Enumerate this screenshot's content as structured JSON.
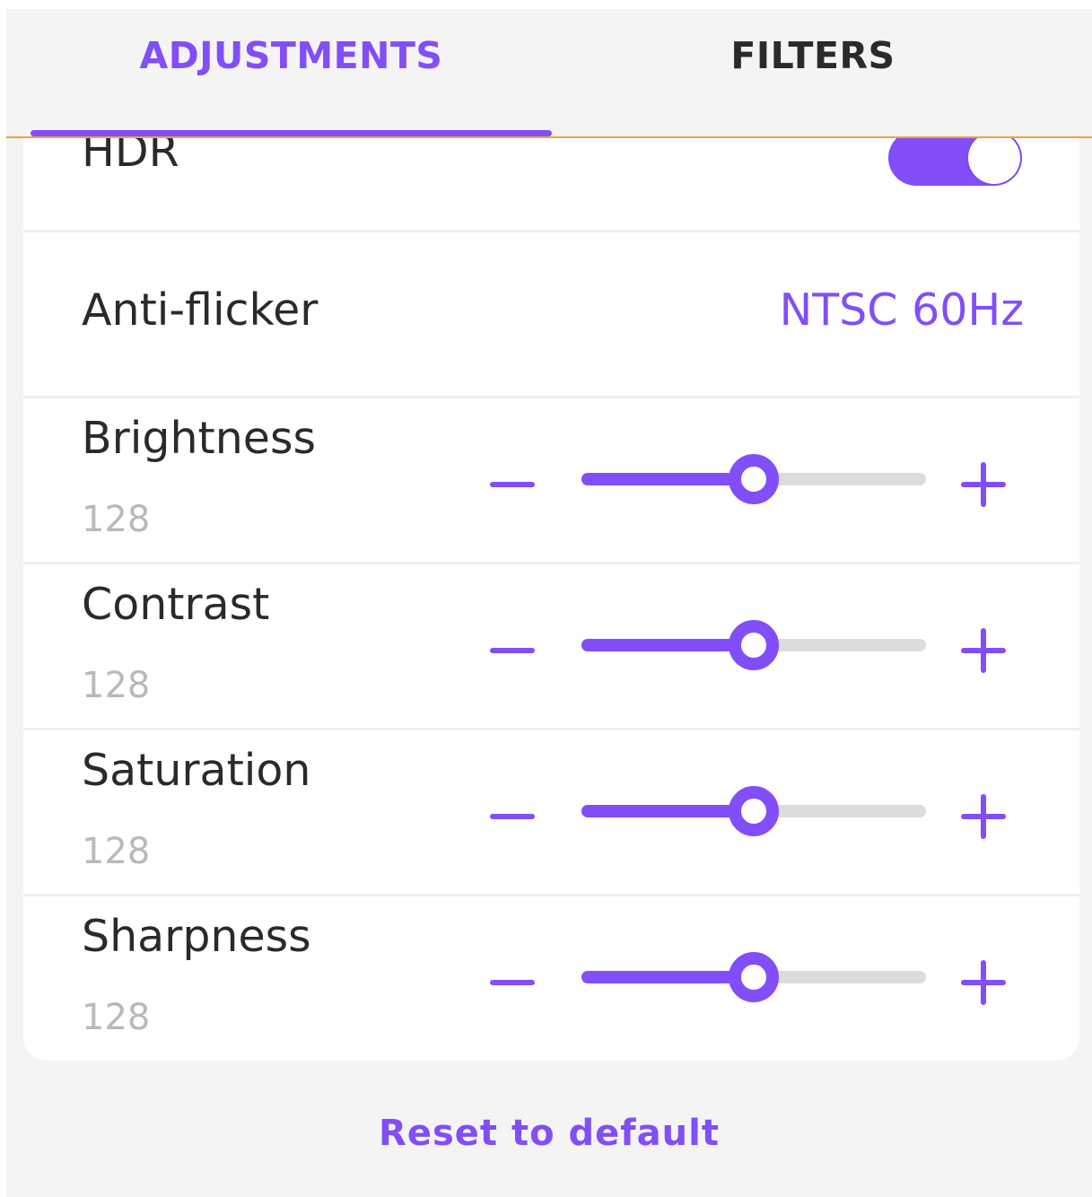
{
  "colors": {
    "accent": "#814efa",
    "separator": "#f0a23a",
    "text_dark": "#2a2a2a",
    "text_muted": "#b9b9b9"
  },
  "tabs": [
    {
      "label": "ADJUSTMENTS",
      "active": true
    },
    {
      "label": "FILTERS",
      "active": false
    }
  ],
  "hdr": {
    "label": "HDR",
    "enabled": true
  },
  "anti_flicker": {
    "label": "Anti-flicker",
    "value": "NTSC 60Hz"
  },
  "sliders": [
    {
      "label": "Brightness",
      "value": "128",
      "fraction": 0.5
    },
    {
      "label": "Contrast",
      "value": "128",
      "fraction": 0.5
    },
    {
      "label": "Saturation",
      "value": "128",
      "fraction": 0.5
    },
    {
      "label": "Sharpness",
      "value": "128",
      "fraction": 0.5
    }
  ],
  "reset": {
    "label": "Reset to default"
  }
}
